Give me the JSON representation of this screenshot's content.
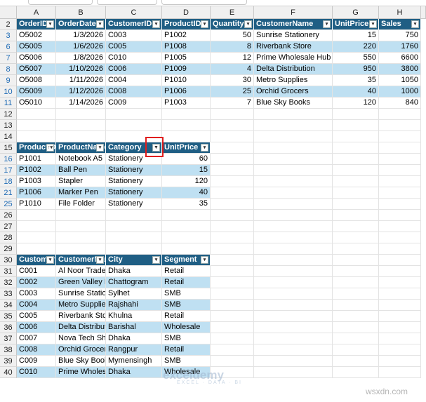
{
  "columns": [
    "A",
    "B",
    "C",
    "D",
    "E",
    "F",
    "G",
    "H"
  ],
  "rows_visible": [
    "2",
    "3",
    "6",
    "7",
    "8",
    "9",
    "10",
    "11",
    "12",
    "13",
    "14",
    "15",
    "16",
    "17",
    "18",
    "21",
    "25",
    "26",
    "27",
    "28",
    "29",
    "30",
    "31",
    "32",
    "33",
    "34",
    "35",
    "36",
    "37",
    "38",
    "39",
    "40"
  ],
  "filtered_rows": [
    "3",
    "6",
    "7",
    "8",
    "9",
    "10",
    "11",
    "16",
    "17",
    "18",
    "21",
    "25"
  ],
  "orders": {
    "headers": [
      "OrderID",
      "OrderDate",
      "CustomerID",
      "ProductID",
      "Quantity",
      "CustomerName",
      "UnitPrice",
      "Sales"
    ],
    "rows": [
      [
        "O5002",
        "1/3/2026",
        "C003",
        "P1002",
        "50",
        "Sunrise Stationery",
        "15",
        "750"
      ],
      [
        "O5005",
        "1/6/2026",
        "C005",
        "P1008",
        "8",
        "Riverbank Store",
        "220",
        "1760"
      ],
      [
        "O5006",
        "1/8/2026",
        "C010",
        "P1005",
        "12",
        "Prime Wholesale Hub",
        "550",
        "6600"
      ],
      [
        "O5007",
        "1/10/2026",
        "C006",
        "P1009",
        "4",
        "Delta Distribution",
        "950",
        "3800"
      ],
      [
        "O5008",
        "1/11/2026",
        "C004",
        "P1010",
        "30",
        "Metro Supplies",
        "35",
        "1050"
      ],
      [
        "O5009",
        "1/12/2026",
        "C008",
        "P1006",
        "25",
        "Orchid Grocers",
        "40",
        "1000"
      ],
      [
        "O5010",
        "1/14/2026",
        "C009",
        "P1003",
        "7",
        "Blue Sky Books",
        "120",
        "840"
      ]
    ]
  },
  "products": {
    "headers": [
      "ProductID",
      "ProductName",
      "Category",
      "UnitPrice"
    ],
    "rows": [
      [
        "P1001",
        "Notebook A5",
        "Stationery",
        "60"
      ],
      [
        "P1002",
        "Ball Pen",
        "Stationery",
        "15"
      ],
      [
        "P1003",
        "Stapler",
        "Stationery",
        "120"
      ],
      [
        "P1006",
        "Marker Pen",
        "Stationery",
        "40"
      ],
      [
        "P1010",
        "File Folder",
        "Stationery",
        "35"
      ]
    ]
  },
  "customers": {
    "headers": [
      "CustomerID",
      "CustomerName",
      "City",
      "Segment"
    ],
    "rows": [
      [
        "C001",
        "Al Noor Traders",
        "Dhaka",
        "Retail"
      ],
      [
        "C002",
        "Green Valley Mart",
        "Chattogram",
        "Retail"
      ],
      [
        "C003",
        "Sunrise Stationery",
        "Sylhet",
        "SMB"
      ],
      [
        "C004",
        "Metro Supplies",
        "Rajshahi",
        "SMB"
      ],
      [
        "C005",
        "Riverbank Store",
        "Khulna",
        "Retail"
      ],
      [
        "C006",
        "Delta Distribution",
        "Barishal",
        "Wholesale"
      ],
      [
        "C007",
        "Nova Tech Shop",
        "Dhaka",
        "SMB"
      ],
      [
        "C008",
        "Orchid Grocers",
        "Rangpur",
        "Retail"
      ],
      [
        "C009",
        "Blue Sky Books",
        "Mymensingh",
        "SMB"
      ],
      [
        "C010",
        "Prime Wholesale Hub",
        "Dhaka",
        "Wholesale"
      ]
    ]
  },
  "watermark": {
    "brand": "exceldemy",
    "tagline": "EXCEL · DATA · BI",
    "site": "wsxdn.com"
  },
  "colors": {
    "header": "#1f5e84",
    "band": "#bfe0f2",
    "highlight": "#e01e1e",
    "filtered_row_number": "#1f6bb5"
  }
}
